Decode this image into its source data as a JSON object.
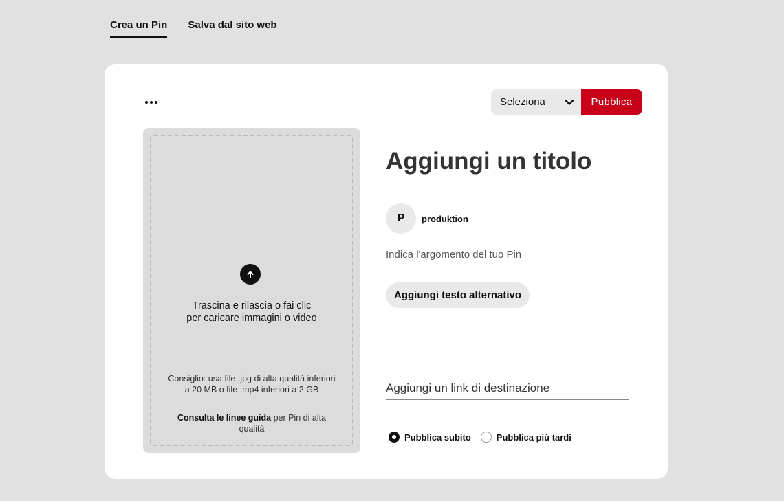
{
  "tabs": [
    {
      "label": "Crea un Pin",
      "active": true
    },
    {
      "label": "Salva dal sito web",
      "active": false
    }
  ],
  "toolbar": {
    "more_icon": "more-horizontal-icon",
    "board_select_value": "Seleziona",
    "publish_label": "Pubblica"
  },
  "upload": {
    "icon": "arrow-up-circle-icon",
    "line1": "Trascina e rilascia o fai clic",
    "line2": "per caricare immagini o video",
    "tip": "Consiglio: usa file .jpg di alta qualità inferiori a 20 MB o file .mp4 inferiori a 2 GB",
    "guide_link": "Consulta le linee guida",
    "guide_rest": "per Pin di alta qualità"
  },
  "form": {
    "title_placeholder": "Aggiungi un titolo",
    "user": {
      "initial": "P",
      "name": "produktion"
    },
    "about_placeholder": "Indica l'argomento del tuo Pin",
    "alt_text_label": "Aggiungi testo alternativo",
    "link_placeholder": "Aggiungi un link di destinazione"
  },
  "publish_options": {
    "now_label": "Pubblica subito",
    "later_label": "Pubblica più tardi",
    "selected": "now"
  },
  "colors": {
    "accent": "#c8001a",
    "background": "#e1e1e1",
    "card": "#ffffff"
  }
}
